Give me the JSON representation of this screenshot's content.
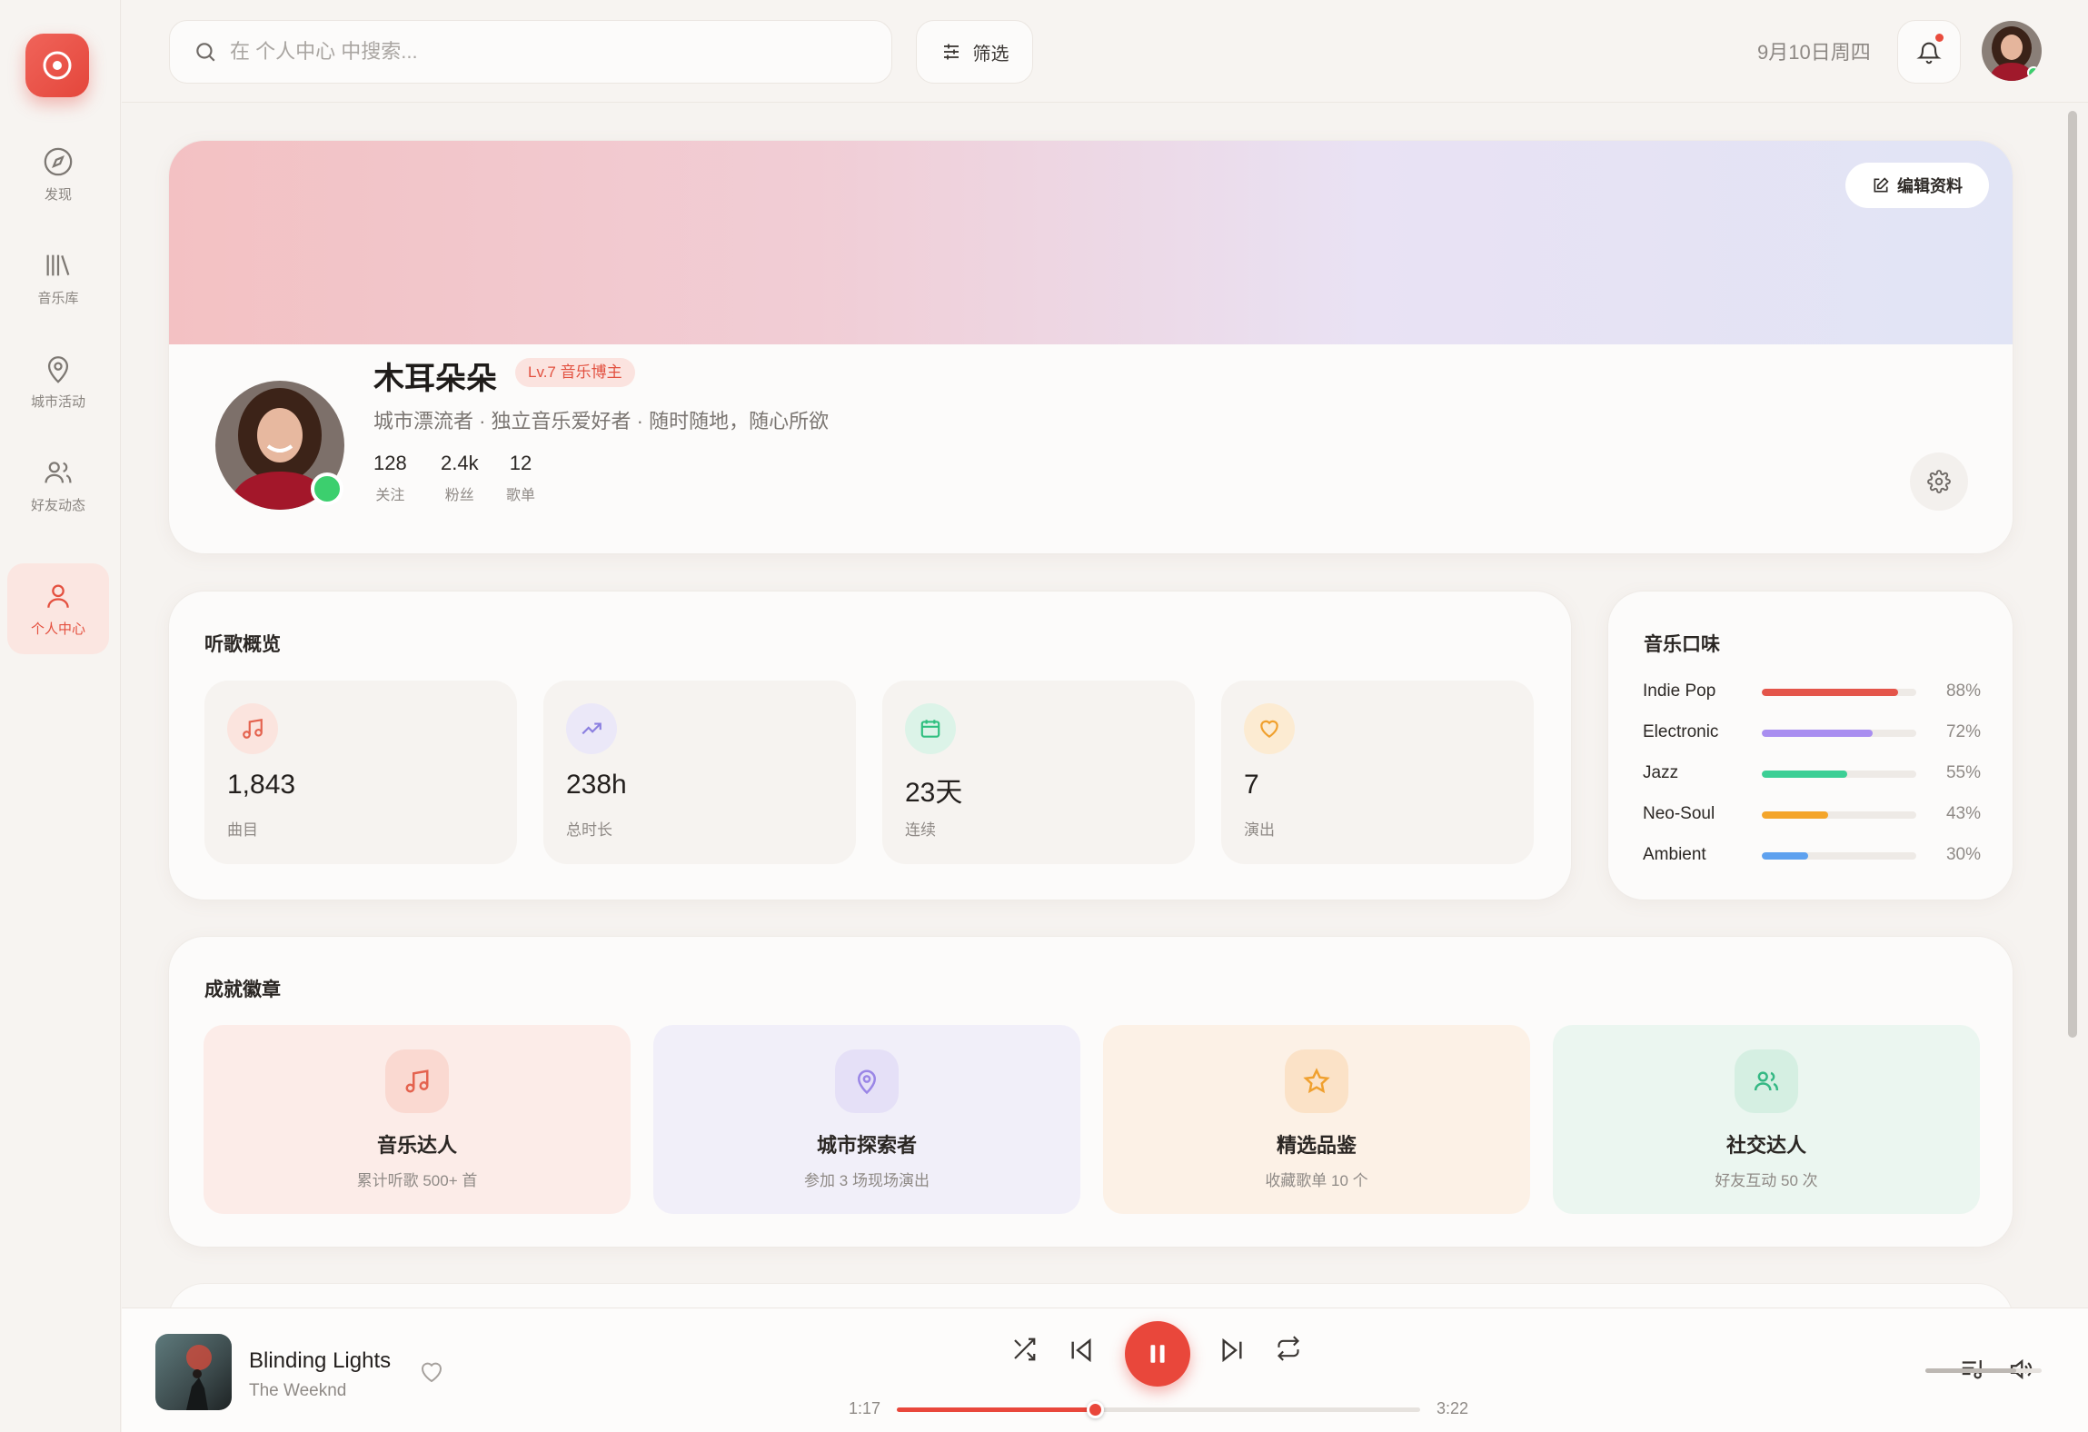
{
  "nav": {
    "items": [
      {
        "label": "发现",
        "icon": "compass-icon"
      },
      {
        "label": "音乐库",
        "icon": "library-icon"
      },
      {
        "label": "城市活动",
        "icon": "map-pin-icon"
      },
      {
        "label": "好友动态",
        "icon": "users-icon"
      },
      {
        "label": "个人中心",
        "icon": "user-icon",
        "active": true
      }
    ]
  },
  "topbar": {
    "search_placeholder": "在 个人中心 中搜索...",
    "filter_label": "筛选",
    "date": "9月10日周四"
  },
  "profile": {
    "edit_label": "编辑资料",
    "name": "木耳朵朵",
    "level": "Lv.7 音乐博主",
    "bio": "城市漂流者 · 独立音乐爱好者 · 随时随地，随心所欲",
    "stats": [
      {
        "value": "128",
        "label": "关注"
      },
      {
        "value": "2.4k",
        "label": "粉丝"
      },
      {
        "value": "12",
        "label": "歌单"
      }
    ]
  },
  "overview": {
    "title": "听歌概览",
    "tiles": [
      {
        "value": "1,843",
        "label": "曲目",
        "icon": "music-note-icon",
        "color": "#e4634f",
        "bg": "#fbe4de"
      },
      {
        "value": "238h",
        "label": "总时长",
        "icon": "trending-up-icon",
        "color": "#8b7fe0",
        "bg": "#ebe8f8"
      },
      {
        "value": "23天",
        "label": "连续",
        "icon": "calendar-icon",
        "color": "#2fbf7f",
        "bg": "#dcf3e8"
      },
      {
        "value": "7",
        "label": "演出",
        "icon": "heart-icon",
        "color": "#f0a02e",
        "bg": "#fcebd2"
      }
    ]
  },
  "taste": {
    "title": "音乐口味",
    "genres": [
      {
        "name": "Indie Pop",
        "percent": 88,
        "pct_label": "88%",
        "color": "#e4554a"
      },
      {
        "name": "Electronic",
        "percent": 72,
        "pct_label": "72%",
        "color": "#a98ef0"
      },
      {
        "name": "Jazz",
        "percent": 55,
        "pct_label": "55%",
        "color": "#3ccf95"
      },
      {
        "name": "Neo-Soul",
        "percent": 43,
        "pct_label": "43%",
        "color": "#f4a52a"
      },
      {
        "name": "Ambient",
        "percent": 30,
        "pct_label": "30%",
        "color": "#5ea1ef"
      }
    ]
  },
  "badges": {
    "title": "成就徽章",
    "items": [
      {
        "title": "音乐达人",
        "desc": "累计听歌 500+ 首",
        "icon": "music-note-icon",
        "color": "#e4634f",
        "bg": "#fcece8",
        "icon_bg": "#fad9d1"
      },
      {
        "title": "城市探索者",
        "desc": "参加 3 场现场演出",
        "icon": "map-pin-icon",
        "color": "#9a86e6",
        "bg": "#f1eff9",
        "icon_bg": "#e5e0f7"
      },
      {
        "title": "精选品鉴",
        "desc": "收藏歌单 10 个",
        "icon": "star-icon",
        "color": "#f0a02e",
        "bg": "#fcf1e6",
        "icon_bg": "#fbe2c7"
      },
      {
        "title": "社交达人",
        "desc": "好友互动 50 次",
        "icon": "users-icon",
        "color": "#35b884",
        "bg": "#ebf6f0",
        "icon_bg": "#d5efe2"
      }
    ]
  },
  "player": {
    "song": "Blinding Lights",
    "artist": "The Weeknd",
    "current_time": "1:17",
    "total_time": "3:22",
    "progress": 0.38,
    "volume": 0.78
  }
}
